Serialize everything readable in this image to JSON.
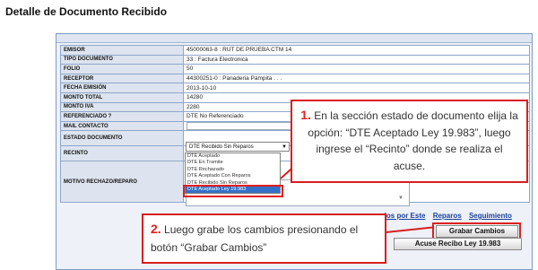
{
  "page_title": "Detalle de Documento Recibido",
  "form": {
    "rows": [
      {
        "label": "EMISOR",
        "value": "45000063-8 : RUT DE PRUEBA CTM 14"
      },
      {
        "label": "TIPO DOCUMENTO",
        "value": "33 : Factura Electronica"
      },
      {
        "label": "FOLIO",
        "value": "50"
      },
      {
        "label": "RECEPTOR",
        "value": "44300251-0 : Panaderia Pampita . . ."
      },
      {
        "label": "FECHA EMISIÓN",
        "value": "2013-10-10"
      },
      {
        "label": "MONTO TOTAL",
        "value": "14280"
      },
      {
        "label": "MONTO IVA",
        "value": "2280"
      },
      {
        "label": "REFERENCIADO ?",
        "value": "DTE No Referenciado"
      },
      {
        "label": "MAIL CONTACTO",
        "value": ""
      }
    ],
    "estado_label": "ESTADO DOCUMENTO",
    "estado_selected": "DTE Recibido Sin Reparos",
    "recinto_label": "RECINTO",
    "motivo_label": "MOTIVO RECHAZO/REPARO",
    "dropdown_options": [
      "DTE Aceptado",
      "DTE En Tramite",
      "DTE Rechazado",
      "DTE Aceptado Con Reparos",
      "DTE Recibido Sin Reparos",
      "DTE Aceptado Ley 19.983"
    ]
  },
  "links": {
    "partial_link": "dos por Este",
    "reparos": "Reparos",
    "seguimiento": "Seguimiento"
  },
  "buttons": {
    "grabar": "Grabar Cambios",
    "acuse": "Acuse Recibo Ley 19.983"
  },
  "callouts": {
    "c1_num": "1.",
    "c1_text": " En la sección estado de documento elija la opción: “DTE Aceptado Ley 19.983”, luego ingrese el “Recinto” donde se realiza el acuse.",
    "c2_num": "2.",
    "c2_text": " Luego grabe los cambios  presionando el botón “Grabar Cambios”"
  },
  "colors": {
    "highlight": "#e0201c",
    "label_bg": "#dde4ef",
    "link": "#1a3f9c"
  }
}
